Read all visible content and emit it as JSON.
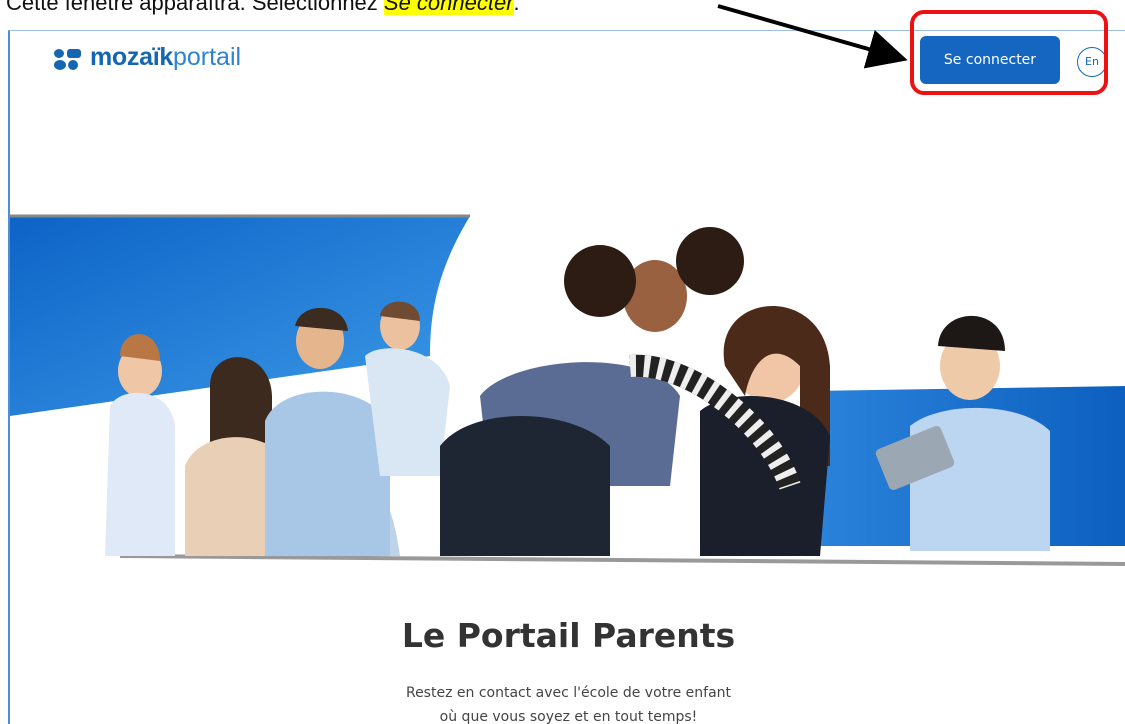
{
  "instruction": {
    "prefix": "Cette fenêtre apparaîtra. Sélectionnez ",
    "highlight": "Se connecter",
    "suffix": "."
  },
  "header": {
    "logo_bold": "mozaïk",
    "logo_light": "portail",
    "login_label": "Se connecter",
    "language_label": "En"
  },
  "main": {
    "title": "Le Portail Parents",
    "subtitle_line1": "Restez en contact avec l'école de votre enfant",
    "subtitle_line2": "où que vous soyez et en tout temps!"
  },
  "colors": {
    "brand": "#1566b0",
    "button": "#1566c0",
    "annotation": "#ee1111",
    "highlight": "#ffff00"
  },
  "icons": {
    "logo": "mozaik-logo-icon",
    "arrow": "annotation-arrow",
    "hero": "hero-family-photo"
  }
}
